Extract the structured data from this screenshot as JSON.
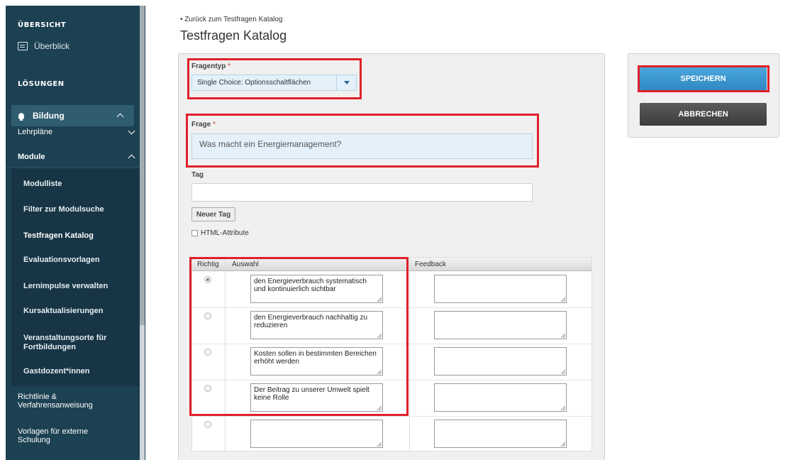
{
  "sidebar": {
    "section_overview": "ÜBERSICHT",
    "overview_item": "Überblick",
    "section_solutions": "LÖSUNGEN",
    "bildung": "Bildung",
    "lehrplaene": "Lehrpläne",
    "module": "Module",
    "module_items": [
      "Modulliste",
      "Filter zur Modulsuche",
      "Testfragen Katalog",
      "Evaluationsvorlagen",
      "Lernimpulse verwalten",
      "Kursaktualisierungen",
      "Veranstaltungsorte für Fortbildungen",
      "Gastdozent*innen"
    ],
    "bottom_items": [
      "Richtlinie & Verfahrensanweisung",
      "Vorlagen für externe Schulung"
    ]
  },
  "breadcrumb": "• Zurück zum Testfragen Katalog",
  "page_title": "Testfragen Katalog",
  "form": {
    "fragentyp_label": "Fragentyp",
    "required_mark": "*",
    "fragentyp_value": "Single Choice: Optionsschaltflächen",
    "frage_label": "Frage",
    "frage_value": "Was macht ein Energiemanagement?",
    "tag_label": "Tag",
    "tag_value": "",
    "new_tag_button": "Neuer Tag",
    "html_attr_label": "HTML-Attribute"
  },
  "answers": {
    "headers": {
      "correct": "Richtig",
      "choice": "Auswahl",
      "feedback": "Feedback"
    },
    "rows": [
      {
        "correct": true,
        "choice": "den Energieverbrauch systematisch und kontinuierlich sichtbar",
        "feedback": ""
      },
      {
        "correct": false,
        "choice": "den Energieverbrauch nachhaltig zu reduzieren",
        "feedback": ""
      },
      {
        "correct": false,
        "choice": "Kosten sollen in bestimmten Bereichen erhöht werden",
        "feedback": ""
      },
      {
        "correct": false,
        "choice": "Der Beitrag zu unserer Umwelt spielt keine Rolle",
        "feedback": ""
      },
      {
        "correct": false,
        "choice": "",
        "feedback": ""
      }
    ]
  },
  "actions": {
    "save": "SPEICHERN",
    "cancel": "ABBRECHEN"
  },
  "colors": {
    "sidebar": "#1c4152",
    "save_button": "#3a97d0",
    "cancel_button": "#4a4a4a",
    "highlight": "#e0202a"
  }
}
